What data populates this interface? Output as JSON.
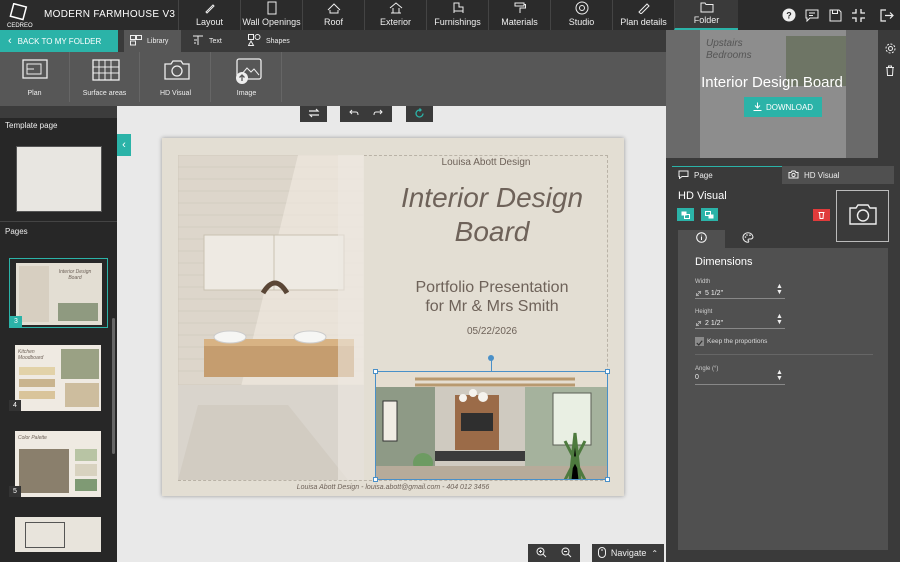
{
  "header": {
    "logo_text": "CEDREO",
    "project_name": "MODERN FARMHOUSE V3",
    "tabs": [
      {
        "label": "Layout",
        "icon": "pencil-icon"
      },
      {
        "label": "Wall Openings",
        "icon": "door-icon"
      },
      {
        "label": "Roof",
        "icon": "roof-icon"
      },
      {
        "label": "Exterior",
        "icon": "exterior-icon"
      },
      {
        "label": "Furnishings",
        "icon": "furniture-icon"
      },
      {
        "label": "Materials",
        "icon": "paint-roller-icon"
      },
      {
        "label": "Studio",
        "icon": "aperture-icon"
      },
      {
        "label": "Plan details",
        "icon": "plan-details-icon"
      },
      {
        "label": "Folder",
        "icon": "folder-icon"
      }
    ],
    "active_tab": "Folder"
  },
  "subbar": {
    "back_label": "BACK TO MY FOLDER",
    "tabs": [
      {
        "label": "Library",
        "icon": "library-icon"
      },
      {
        "label": "Text",
        "icon": "text-icon"
      },
      {
        "label": "Shapes",
        "icon": "shapes-icon"
      }
    ]
  },
  "tools": [
    {
      "label": "Plan",
      "icon": "plan-icon"
    },
    {
      "label": "Surface areas",
      "icon": "surface-areas-icon"
    },
    {
      "label": "HD Visual",
      "icon": "camera-icon"
    },
    {
      "label": "Image",
      "icon": "image-upload-icon"
    }
  ],
  "left_panel": {
    "template_heading": "Template page",
    "pages_heading": "Pages",
    "pages": [
      {
        "number": "3",
        "title": "Interior Design Board"
      },
      {
        "number": "4",
        "title": "Kitchen Moodboard"
      },
      {
        "number": "5",
        "title": "Color Palette"
      }
    ]
  },
  "board": {
    "designer": "Louisa Abott Design",
    "title_line1": "Interior Design",
    "title_line2": "Board",
    "subtitle_line1": "Portfolio Presentation",
    "subtitle_line2": "for Mr & Mrs Smith",
    "date": "05/22/2026",
    "footer": "Louisa Abott Design - louisa.abott@gmail.com - 404 012 3456"
  },
  "bottom_controls": {
    "navigate_label": "Navigate"
  },
  "right_panel": {
    "preview": {
      "bg_text_line1": "Upstairs",
      "bg_text_line2": "Bedrooms",
      "title": "Interior Design Board",
      "download_label": "DOWNLOAD"
    },
    "tabs": [
      {
        "label": "Page",
        "icon": "page-icon"
      },
      {
        "label": "HD Visual",
        "icon": "camera-icon"
      }
    ],
    "section_title": "HD Visual",
    "dimensions": {
      "heading": "Dimensions",
      "width_label": "Width",
      "width_value": "5 1/2\"",
      "height_label": "Height",
      "height_value": "2 1/2\"",
      "keep_proportions_label": "Keep the proportions",
      "keep_proportions_checked": true,
      "angle_label": "Angle (°)",
      "angle_value": "0"
    }
  },
  "colors": {
    "accent": "#2bb3a8",
    "danger": "#e03b3b",
    "topbar": "#2b2b2b",
    "panel": "#3a3a3a",
    "toolbar": "#575757",
    "canvas": "#e9e9e9",
    "board_text": "#6e6259"
  }
}
